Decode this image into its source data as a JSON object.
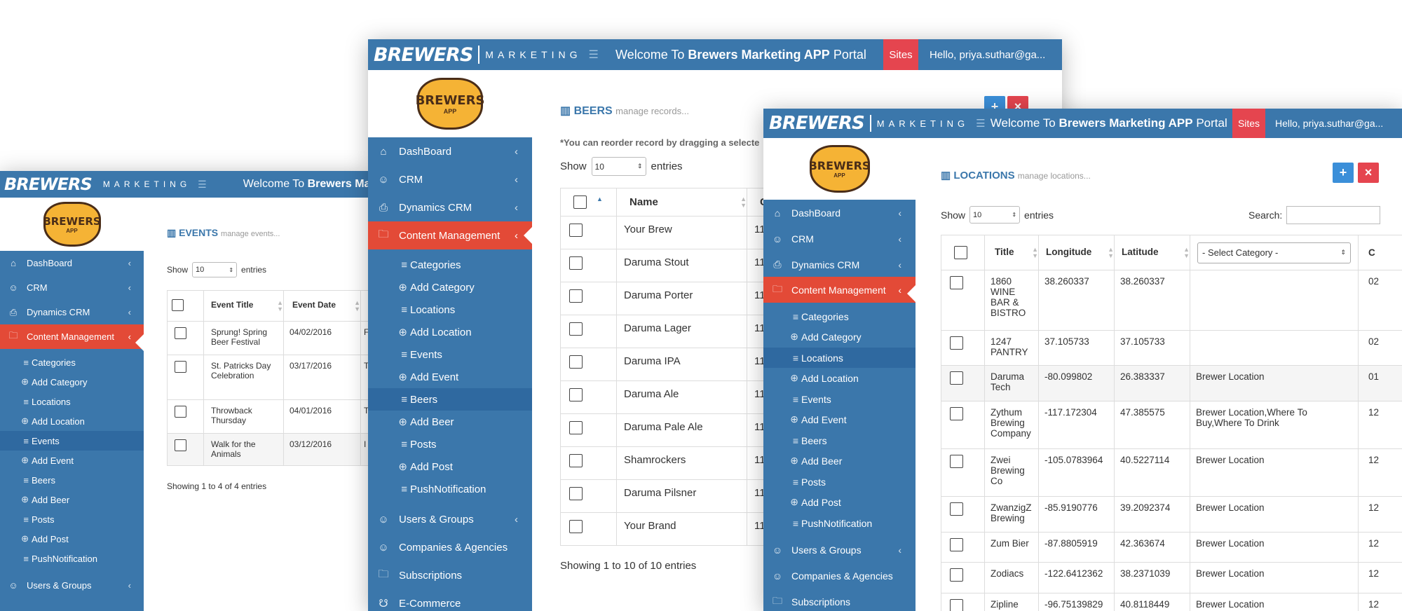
{
  "brand": {
    "name": "BREWERS",
    "sub": "MARKETING",
    "logo_text": "BREWERS",
    "logo_sub": "APP"
  },
  "header": {
    "welcome_prefix": "Welcome To ",
    "welcome_bold": "Brewers Marketing APP",
    "welcome_suffix": " Portal",
    "welcome_truncated": "Brewers Marketi",
    "sites": "Sites",
    "hello": "Hello, priya.suthar@ga..."
  },
  "nav": {
    "dashboard": "DashBoard",
    "crm": "CRM",
    "dynamics": "Dynamics CRM",
    "content": "Content Management",
    "categories": "Categories",
    "add_category": "Add Category",
    "locations": "Locations",
    "add_location": "Add Location",
    "events": "Events",
    "add_event": "Add Event",
    "beers": "Beers",
    "add_beer": "Add Beer",
    "posts": "Posts",
    "add_post": "Add Post",
    "push": "PushNotification",
    "users": "Users & Groups",
    "companies": "Companies & Agencies",
    "subscriptions": "Subscriptions",
    "ecommerce": "E-Commerce"
  },
  "common": {
    "show": "Show",
    "entries": "entries",
    "page_len": "10",
    "search": "Search:"
  },
  "events_page": {
    "title": "EVENTS",
    "subtitle": "manage events...",
    "columns": [
      "Event Title",
      "Event Date"
    ],
    "rows": [
      {
        "title": "Sprung! Spring Beer Festival",
        "date": "04/02/2016",
        "extra": "F"
      },
      {
        "title": "St. Patricks Day Celebration",
        "date": "03/17/2016",
        "extra": "T"
      },
      {
        "title": "Throwback Thursday",
        "date": "04/01/2016",
        "extra": "T"
      },
      {
        "title": "Walk for the Animals",
        "date": "03/12/2016",
        "extra": "I"
      }
    ],
    "footer": "Showing 1 to 4 of 4 entries"
  },
  "beers_page": {
    "title": "BEERS",
    "subtitle": "manage records...",
    "note": "*You can reorder record by dragging a selecte",
    "columns": [
      "Name",
      "C"
    ],
    "rows": [
      {
        "name": "Your Brew",
        "c": "11"
      },
      {
        "name": "Daruma Stout",
        "c": "11"
      },
      {
        "name": "Daruma Porter",
        "c": "11"
      },
      {
        "name": "Daruma Lager",
        "c": "11"
      },
      {
        "name": "Daruma IPA",
        "c": "11"
      },
      {
        "name": "Daruma Ale",
        "c": "11"
      },
      {
        "name": "Daruma Pale Ale",
        "c": "11"
      },
      {
        "name": "Shamrockers",
        "c": "11"
      },
      {
        "name": "Daruma Pilsner",
        "c": "11"
      },
      {
        "name": "Your Brand",
        "c": "11"
      }
    ],
    "footer": "Showing 1 to 10 of 10 entries"
  },
  "locations_page": {
    "title": "LOCATIONS",
    "subtitle": "manage locations...",
    "columns": [
      "Title",
      "Longitude",
      "Latitude",
      "- Select Category -",
      "C"
    ],
    "rows": [
      {
        "title": "1860 WINE BAR & BISTRO",
        "lon": "38.260337",
        "lat": "38.260337",
        "cat": "",
        "c": "02"
      },
      {
        "title": "1247 PANTRY",
        "lon": "37.105733",
        "lat": "37.105733",
        "cat": "",
        "c": "02"
      },
      {
        "title": "Daruma Tech",
        "lon": "-80.099802",
        "lat": "26.383337",
        "cat": "Brewer Location",
        "c": "01"
      },
      {
        "title": "Zythum Brewing Company",
        "lon": "-117.172304",
        "lat": "47.385575",
        "cat": "Brewer Location,Where To Buy,Where To Drink",
        "c": "12"
      },
      {
        "title": "Zwei Brewing Co",
        "lon": "-105.0783964",
        "lat": "40.5227114",
        "cat": "Brewer Location",
        "c": "12"
      },
      {
        "title": "ZwanzigZ Brewing",
        "lon": "-85.9190776",
        "lat": "39.2092374",
        "cat": "Brewer Location",
        "c": "12"
      },
      {
        "title": "Zum Bier",
        "lon": "-87.8805919",
        "lat": "42.363674",
        "cat": "Brewer Location",
        "c": "12"
      },
      {
        "title": "Zodiacs",
        "lon": "-122.6412362",
        "lat": "38.2371039",
        "cat": "Brewer Location",
        "c": "12"
      },
      {
        "title": "Zipline",
        "lon": "-96.75139829",
        "lat": "40.8118449",
        "cat": "Brewer Location",
        "c": "12"
      }
    ]
  },
  "buttons": {
    "add": "+",
    "close": "×"
  },
  "icons": {
    "dashboard": "home-icon",
    "crm": "user-icon",
    "dynamics": "printer-icon",
    "content": "folder-icon",
    "list": "list-icon",
    "add": "plus-circle-icon",
    "users": "users-icon",
    "companies": "user-icon",
    "subscriptions": "folder-icon",
    "ecommerce": "cart-icon",
    "title": "briefcase-icon"
  },
  "colors": {
    "primary": "#3b77ab",
    "active": "#e34a37",
    "sites": "#e5454f",
    "add_button": "#3b8fd9",
    "selected": "#2f69a0"
  }
}
